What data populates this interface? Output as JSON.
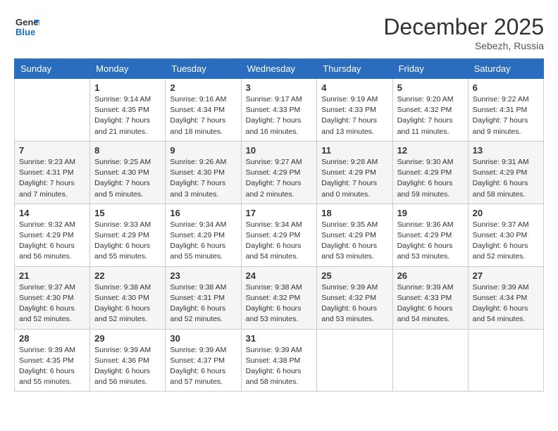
{
  "header": {
    "logo_line1": "General",
    "logo_line2": "Blue",
    "month": "December 2025",
    "location": "Sebezh, Russia"
  },
  "weekdays": [
    "Sunday",
    "Monday",
    "Tuesday",
    "Wednesday",
    "Thursday",
    "Friday",
    "Saturday"
  ],
  "weeks": [
    [
      {
        "day": "",
        "info": ""
      },
      {
        "day": "1",
        "info": "Sunrise: 9:14 AM\nSunset: 4:35 PM\nDaylight: 7 hours\nand 21 minutes."
      },
      {
        "day": "2",
        "info": "Sunrise: 9:16 AM\nSunset: 4:34 PM\nDaylight: 7 hours\nand 18 minutes."
      },
      {
        "day": "3",
        "info": "Sunrise: 9:17 AM\nSunset: 4:33 PM\nDaylight: 7 hours\nand 16 minutes."
      },
      {
        "day": "4",
        "info": "Sunrise: 9:19 AM\nSunset: 4:33 PM\nDaylight: 7 hours\nand 13 minutes."
      },
      {
        "day": "5",
        "info": "Sunrise: 9:20 AM\nSunset: 4:32 PM\nDaylight: 7 hours\nand 11 minutes."
      },
      {
        "day": "6",
        "info": "Sunrise: 9:22 AM\nSunset: 4:31 PM\nDaylight: 7 hours\nand 9 minutes."
      }
    ],
    [
      {
        "day": "7",
        "info": "Sunrise: 9:23 AM\nSunset: 4:31 PM\nDaylight: 7 hours\nand 7 minutes."
      },
      {
        "day": "8",
        "info": "Sunrise: 9:25 AM\nSunset: 4:30 PM\nDaylight: 7 hours\nand 5 minutes."
      },
      {
        "day": "9",
        "info": "Sunrise: 9:26 AM\nSunset: 4:30 PM\nDaylight: 7 hours\nand 3 minutes."
      },
      {
        "day": "10",
        "info": "Sunrise: 9:27 AM\nSunset: 4:29 PM\nDaylight: 7 hours\nand 2 minutes."
      },
      {
        "day": "11",
        "info": "Sunrise: 9:28 AM\nSunset: 4:29 PM\nDaylight: 7 hours\nand 0 minutes."
      },
      {
        "day": "12",
        "info": "Sunrise: 9:30 AM\nSunset: 4:29 PM\nDaylight: 6 hours\nand 59 minutes."
      },
      {
        "day": "13",
        "info": "Sunrise: 9:31 AM\nSunset: 4:29 PM\nDaylight: 6 hours\nand 58 minutes."
      }
    ],
    [
      {
        "day": "14",
        "info": "Sunrise: 9:32 AM\nSunset: 4:29 PM\nDaylight: 6 hours\nand 56 minutes."
      },
      {
        "day": "15",
        "info": "Sunrise: 9:33 AM\nSunset: 4:29 PM\nDaylight: 6 hours\nand 55 minutes."
      },
      {
        "day": "16",
        "info": "Sunrise: 9:34 AM\nSunset: 4:29 PM\nDaylight: 6 hours\nand 55 minutes."
      },
      {
        "day": "17",
        "info": "Sunrise: 9:34 AM\nSunset: 4:29 PM\nDaylight: 6 hours\nand 54 minutes."
      },
      {
        "day": "18",
        "info": "Sunrise: 9:35 AM\nSunset: 4:29 PM\nDaylight: 6 hours\nand 53 minutes."
      },
      {
        "day": "19",
        "info": "Sunrise: 9:36 AM\nSunset: 4:29 PM\nDaylight: 6 hours\nand 53 minutes."
      },
      {
        "day": "20",
        "info": "Sunrise: 9:37 AM\nSunset: 4:30 PM\nDaylight: 6 hours\nand 52 minutes."
      }
    ],
    [
      {
        "day": "21",
        "info": "Sunrise: 9:37 AM\nSunset: 4:30 PM\nDaylight: 6 hours\nand 52 minutes."
      },
      {
        "day": "22",
        "info": "Sunrise: 9:38 AM\nSunset: 4:30 PM\nDaylight: 6 hours\nand 52 minutes."
      },
      {
        "day": "23",
        "info": "Sunrise: 9:38 AM\nSunset: 4:31 PM\nDaylight: 6 hours\nand 52 minutes."
      },
      {
        "day": "24",
        "info": "Sunrise: 9:38 AM\nSunset: 4:32 PM\nDaylight: 6 hours\nand 53 minutes."
      },
      {
        "day": "25",
        "info": "Sunrise: 9:39 AM\nSunset: 4:32 PM\nDaylight: 6 hours\nand 53 minutes."
      },
      {
        "day": "26",
        "info": "Sunrise: 9:39 AM\nSunset: 4:33 PM\nDaylight: 6 hours\nand 54 minutes."
      },
      {
        "day": "27",
        "info": "Sunrise: 9:39 AM\nSunset: 4:34 PM\nDaylight: 6 hours\nand 54 minutes."
      }
    ],
    [
      {
        "day": "28",
        "info": "Sunrise: 9:39 AM\nSunset: 4:35 PM\nDaylight: 6 hours\nand 55 minutes."
      },
      {
        "day": "29",
        "info": "Sunrise: 9:39 AM\nSunset: 4:36 PM\nDaylight: 6 hours\nand 56 minutes."
      },
      {
        "day": "30",
        "info": "Sunrise: 9:39 AM\nSunset: 4:37 PM\nDaylight: 6 hours\nand 57 minutes."
      },
      {
        "day": "31",
        "info": "Sunrise: 9:39 AM\nSunset: 4:38 PM\nDaylight: 6 hours\nand 58 minutes."
      },
      {
        "day": "",
        "info": ""
      },
      {
        "day": "",
        "info": ""
      },
      {
        "day": "",
        "info": ""
      }
    ]
  ]
}
